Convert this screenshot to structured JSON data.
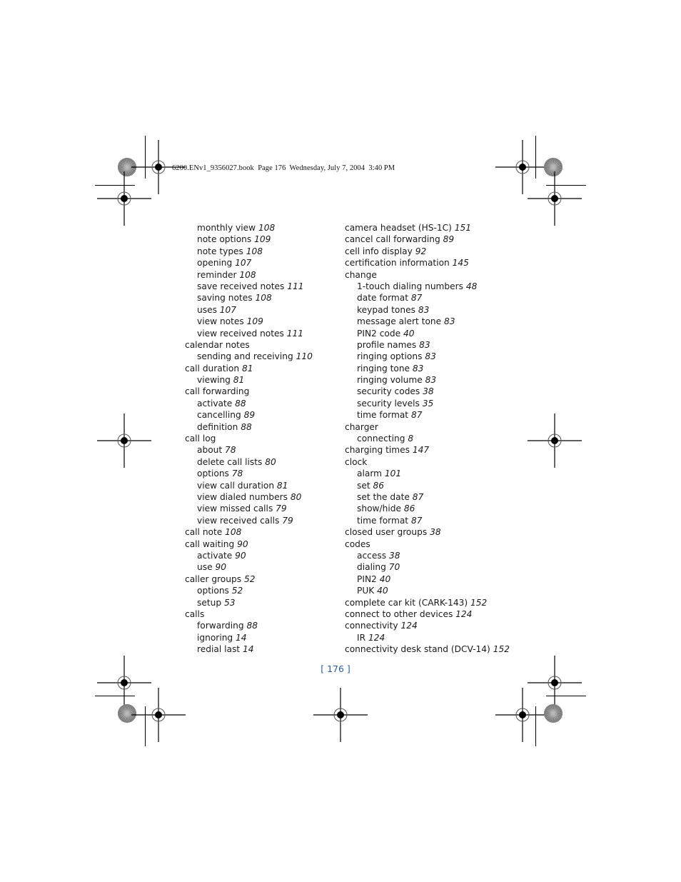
{
  "header": {
    "print_info": "6200.ENv1_9356027.book  Page 176  Wednesday, July 7, 2004  3:40 PM"
  },
  "index": {
    "left_column": [
      {
        "term": "monthly view",
        "page": "108",
        "level": 2
      },
      {
        "term": "note options",
        "page": "109",
        "level": 2
      },
      {
        "term": "note types",
        "page": "108",
        "level": 2
      },
      {
        "term": "opening",
        "page": "107",
        "level": 2
      },
      {
        "term": "reminder",
        "page": "108",
        "level": 2
      },
      {
        "term": "save received notes",
        "page": "111",
        "level": 2
      },
      {
        "term": "saving notes",
        "page": "108",
        "level": 2
      },
      {
        "term": "uses",
        "page": "107",
        "level": 2
      },
      {
        "term": "view notes",
        "page": "109",
        "level": 2
      },
      {
        "term": "view received notes",
        "page": "111",
        "level": 2
      },
      {
        "term": "calendar notes",
        "page": "",
        "level": 1
      },
      {
        "term": "sending and receiving",
        "page": "110",
        "level": 2
      },
      {
        "term": "call duration",
        "page": "81",
        "level": 1
      },
      {
        "term": "viewing",
        "page": "81",
        "level": 2
      },
      {
        "term": "call forwarding",
        "page": "",
        "level": 1
      },
      {
        "term": "activate",
        "page": "88",
        "level": 2
      },
      {
        "term": "cancelling",
        "page": "89",
        "level": 2
      },
      {
        "term": "definition",
        "page": "88",
        "level": 2
      },
      {
        "term": "call log",
        "page": "",
        "level": 1
      },
      {
        "term": "about",
        "page": "78",
        "level": 2
      },
      {
        "term": "delete call lists",
        "page": "80",
        "level": 2
      },
      {
        "term": "options",
        "page": "78",
        "level": 2
      },
      {
        "term": "view call duration",
        "page": "81",
        "level": 2
      },
      {
        "term": "view dialed numbers",
        "page": "80",
        "level": 2
      },
      {
        "term": "view missed calls",
        "page": "79",
        "level": 2
      },
      {
        "term": "view received calls",
        "page": "79",
        "level": 2
      },
      {
        "term": "call note",
        "page": "108",
        "level": 1
      },
      {
        "term": "call waiting",
        "page": "90",
        "level": 1
      },
      {
        "term": "activate",
        "page": "90",
        "level": 2
      },
      {
        "term": "use",
        "page": "90",
        "level": 2
      },
      {
        "term": "caller groups",
        "page": "52",
        "level": 1
      },
      {
        "term": "options",
        "page": "52",
        "level": 2
      },
      {
        "term": "setup",
        "page": "53",
        "level": 2
      },
      {
        "term": "calls",
        "page": "",
        "level": 1
      },
      {
        "term": "forwarding",
        "page": "88",
        "level": 2
      },
      {
        "term": "ignoring",
        "page": "14",
        "level": 2
      },
      {
        "term": "redial last",
        "page": "14",
        "level": 2
      }
    ],
    "right_column": [
      {
        "term": "camera headset (HS-1C)",
        "page": "151",
        "level": 1
      },
      {
        "term": "cancel call forwarding",
        "page": "89",
        "level": 1
      },
      {
        "term": "cell info display",
        "page": "92",
        "level": 1
      },
      {
        "term": "certification information",
        "page": "145",
        "level": 1
      },
      {
        "term": "change",
        "page": "",
        "level": 1
      },
      {
        "term": "1-touch dialing numbers",
        "page": "48",
        "level": 2
      },
      {
        "term": "date format",
        "page": "87",
        "level": 2
      },
      {
        "term": "keypad tones",
        "page": "83",
        "level": 2
      },
      {
        "term": "message alert tone",
        "page": "83",
        "level": 2
      },
      {
        "term": "PIN2 code",
        "page": "40",
        "level": 2
      },
      {
        "term": "profile names",
        "page": "83",
        "level": 2
      },
      {
        "term": "ringing options",
        "page": "83",
        "level": 2
      },
      {
        "term": "ringing tone",
        "page": "83",
        "level": 2
      },
      {
        "term": "ringing volume",
        "page": "83",
        "level": 2
      },
      {
        "term": "security codes",
        "page": "38",
        "level": 2
      },
      {
        "term": "security levels",
        "page": "35",
        "level": 2
      },
      {
        "term": "time format",
        "page": "87",
        "level": 2
      },
      {
        "term": "charger",
        "page": "",
        "level": 1
      },
      {
        "term": "connecting",
        "page": "8",
        "level": 2
      },
      {
        "term": "charging times",
        "page": "147",
        "level": 1
      },
      {
        "term": "clock",
        "page": "",
        "level": 1
      },
      {
        "term": "alarm",
        "page": "101",
        "level": 2
      },
      {
        "term": "set",
        "page": "86",
        "level": 2
      },
      {
        "term": "set the date",
        "page": "87",
        "level": 2
      },
      {
        "term": "show/hide",
        "page": "86",
        "level": 2
      },
      {
        "term": "time format",
        "page": "87",
        "level": 2
      },
      {
        "term": "closed user groups",
        "page": "38",
        "level": 1
      },
      {
        "term": "codes",
        "page": "",
        "level": 1
      },
      {
        "term": "access",
        "page": "38",
        "level": 2
      },
      {
        "term": "dialing",
        "page": "70",
        "level": 2
      },
      {
        "term": "PIN2",
        "page": "40",
        "level": 2
      },
      {
        "term": "PUK",
        "page": "40",
        "level": 2
      },
      {
        "term": "complete car kit (CARK-143)",
        "page": "152",
        "level": 1
      },
      {
        "term": "connect to other devices",
        "page": "124",
        "level": 1
      },
      {
        "term": "connectivity",
        "page": "124",
        "level": 1
      },
      {
        "term": "IR",
        "page": "124",
        "level": 2
      },
      {
        "term": "connectivity desk stand (DCV-14)",
        "page": "152",
        "level": 1
      }
    ]
  },
  "footer": {
    "page_number": "[ 176 ]"
  },
  "colors": {
    "text": "#1a1a1a",
    "page_number": "#2a5d9f"
  }
}
